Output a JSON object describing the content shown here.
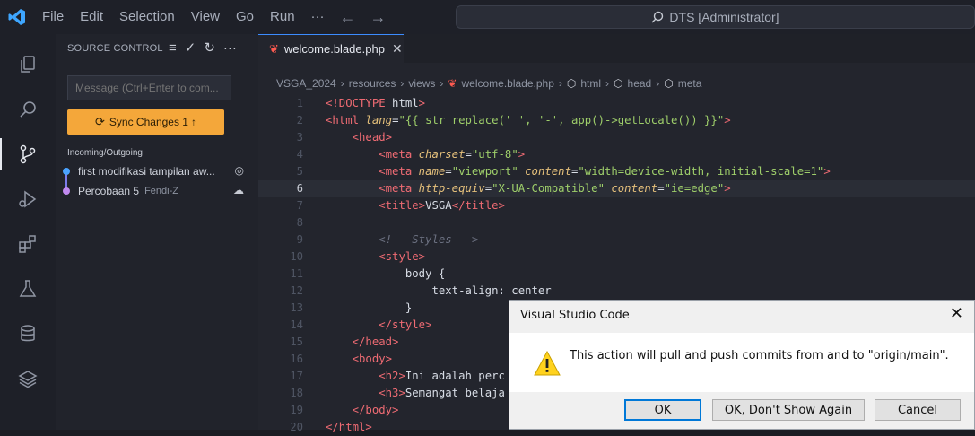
{
  "titlebar": {
    "menu": [
      "File",
      "Edit",
      "Selection",
      "View",
      "Go",
      "Run",
      "···"
    ],
    "search_text": "DTS [Administrator]"
  },
  "activity_icons": [
    "files-icon",
    "search-icon",
    "source-control-icon",
    "run-debug-icon",
    "extensions-icon",
    "testing-icon",
    "database-icon",
    "layers-icon"
  ],
  "sidebar": {
    "header": "SOURCE CONTROL",
    "message_placeholder": "Message (Ctrl+Enter to com...",
    "sync_label": "Sync Changes 1",
    "graph_title": "Incoming/Outgoing",
    "commits": [
      {
        "message": "first modifikasi tampilan aw...",
        "author": "",
        "dot_color": "#4aa3ff"
      },
      {
        "message": "Percobaan 5",
        "author": "Fendi-Z",
        "dot_color": "#c18af0"
      }
    ]
  },
  "editor": {
    "tab_label": "welcome.blade.php",
    "breadcrumb": [
      "VSGA_2024",
      "resources",
      "views",
      "welcome.blade.php",
      "html",
      "head",
      "meta"
    ],
    "lines": [
      {
        "n": "1",
        "t": "<!DOCTYPE html>"
      },
      {
        "n": "2",
        "t": "<html lang=\"{{ str_replace('_', '-', app()->getLocale()) }}\">"
      },
      {
        "n": "3",
        "t": "    <head>"
      },
      {
        "n": "4",
        "t": "        <meta charset=\"utf-8\">"
      },
      {
        "n": "5",
        "t": "        <meta name=\"viewport\" content=\"width=device-width, initial-scale=1\">"
      },
      {
        "n": "6",
        "t": "        <meta http-equiv=\"X-UA-Compatible\" content=\"ie=edge\">"
      },
      {
        "n": "7",
        "t": "        <title>VSGA</title>"
      },
      {
        "n": "8",
        "t": ""
      },
      {
        "n": "9",
        "t": "        <!-- Styles -->"
      },
      {
        "n": "10",
        "t": "        <style>"
      },
      {
        "n": "11",
        "t": "            body {"
      },
      {
        "n": "12",
        "t": "                text-align: center"
      },
      {
        "n": "13",
        "t": "            }"
      },
      {
        "n": "14",
        "t": "        </style>"
      },
      {
        "n": "15",
        "t": "    </head>"
      },
      {
        "n": "16",
        "t": "    <body>"
      },
      {
        "n": "17",
        "t": "        <h2>Ini adalah perc"
      },
      {
        "n": "18",
        "t": "        <h3>Semangat belaja"
      },
      {
        "n": "19",
        "t": "    </body>"
      },
      {
        "n": "20",
        "t": "</html>"
      }
    ]
  },
  "dialog": {
    "title": "Visual Studio Code",
    "message": "This action will pull and push commits from and to \"origin/main\".",
    "ok_label": "OK",
    "ok_dont_show_label": "OK, Don't Show Again",
    "cancel_label": "Cancel"
  }
}
